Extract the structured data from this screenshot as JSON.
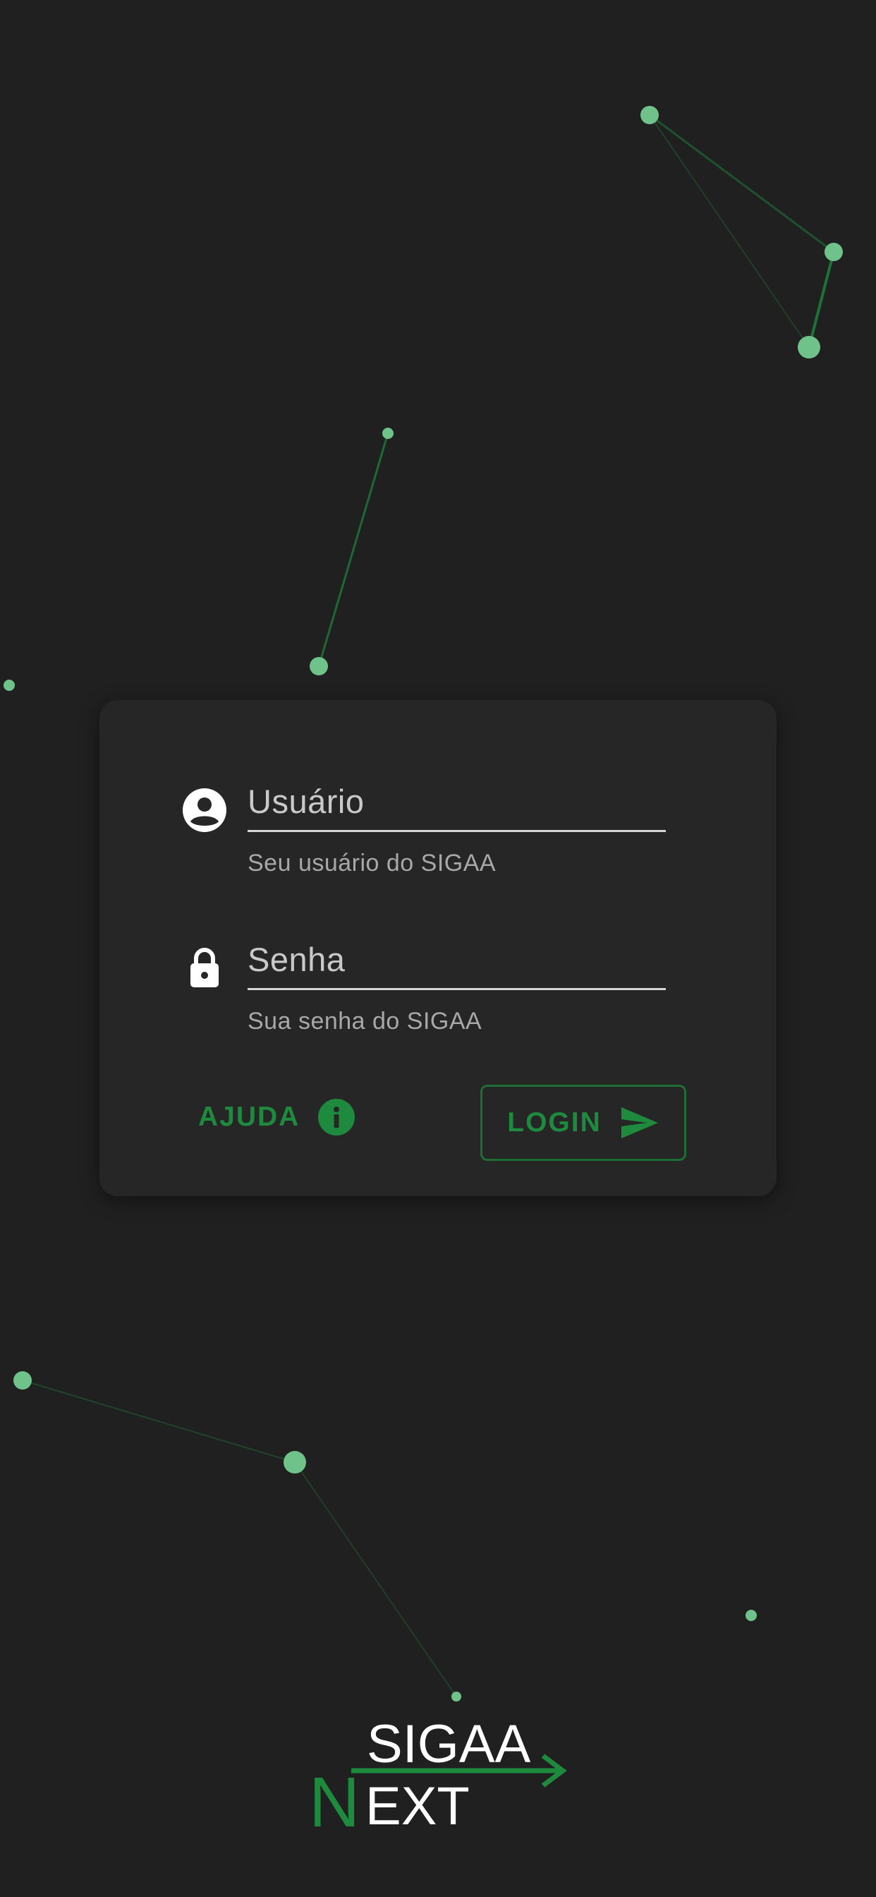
{
  "background": {
    "color": "#202020",
    "node_color": "#6fc289",
    "line_color": "#1e7a3a"
  },
  "login_form": {
    "username": {
      "label": "Usuário",
      "value": "",
      "hint": "Seu usuário do SIGAA",
      "icon": "account-circle-icon"
    },
    "password": {
      "label": "Senha",
      "value": "",
      "hint": "Sua senha do SIGAA",
      "icon": "lock-icon"
    },
    "help_button": {
      "label": "AJUDA",
      "icon": "info-icon"
    },
    "login_button": {
      "label": "LOGIN",
      "icon": "send-icon"
    },
    "accent_color": "#1e8a3e"
  },
  "logo": {
    "top_text": "SIGAA",
    "n_letter": "N",
    "bottom_text": "EXT"
  }
}
